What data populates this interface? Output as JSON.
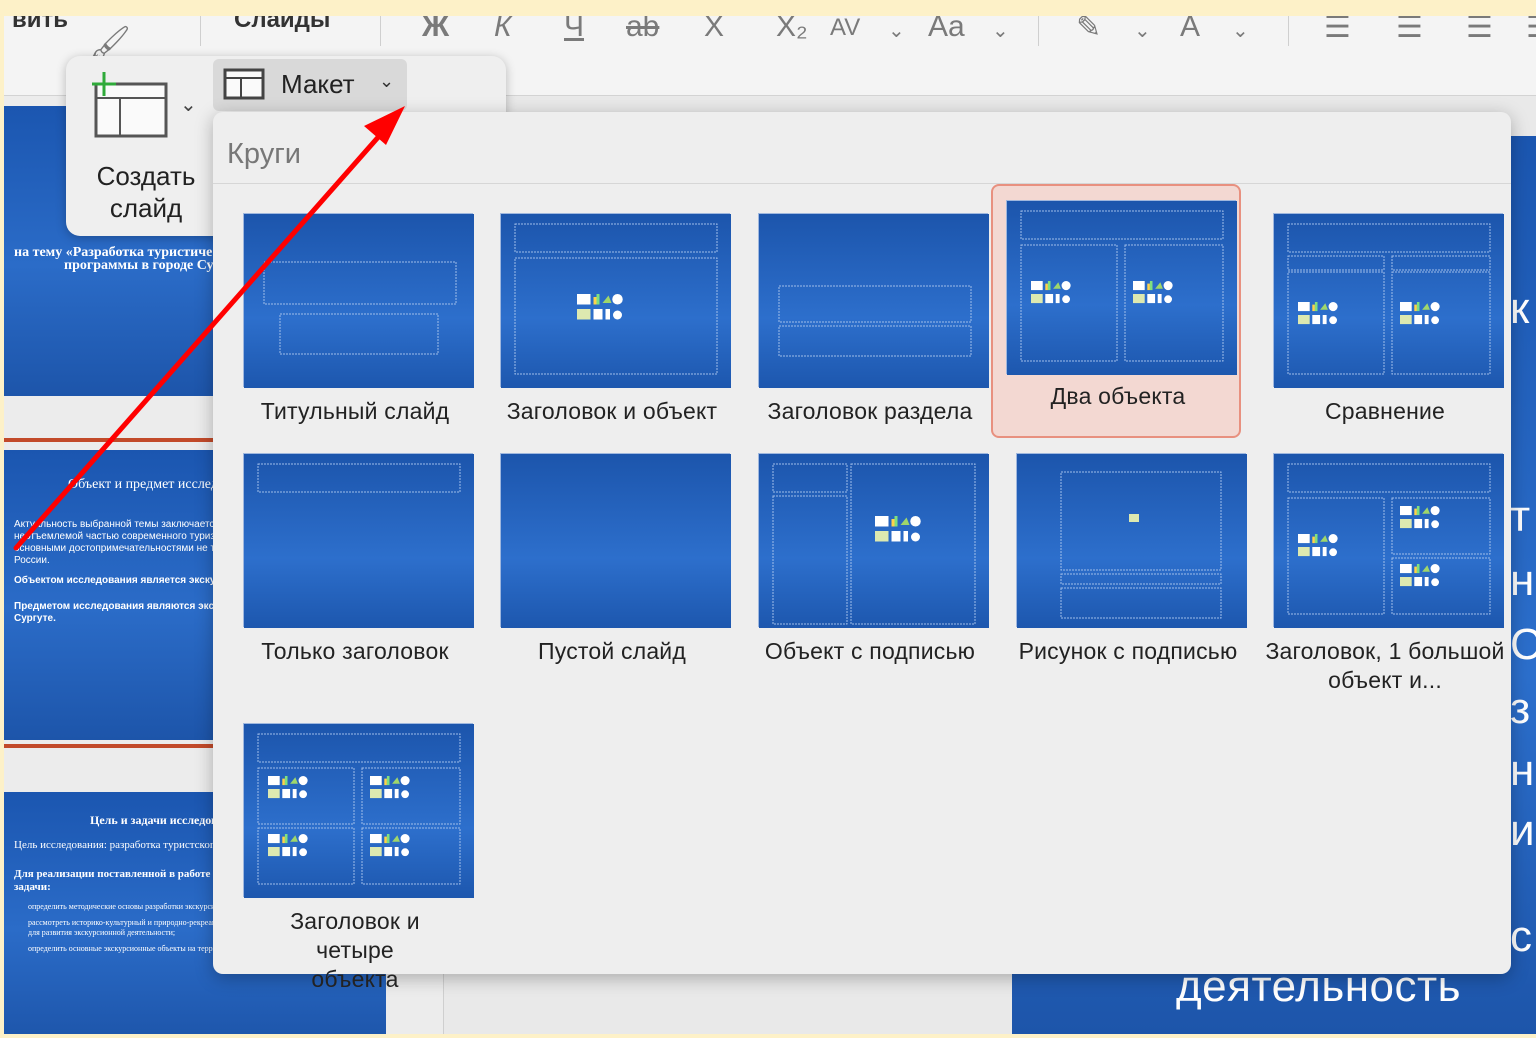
{
  "ribbon": {
    "clipped_left": "вить",
    "slides_tab": "Слайды",
    "font_buttons": [
      "Ж",
      "К",
      "Ч",
      "ab",
      "X",
      "X₂",
      "AV",
      "Aa"
    ]
  },
  "create_slide": {
    "label": "Создать слайд"
  },
  "layout_button": {
    "label": "Макет"
  },
  "gallery": {
    "title": "Круги",
    "layouts": [
      {
        "label": "Титульный слайд",
        "type": "title",
        "selected": false
      },
      {
        "label": "Заголовок и объект",
        "type": "title-content",
        "selected": false
      },
      {
        "label": "Заголовок раздела",
        "type": "section",
        "selected": false
      },
      {
        "label": "Два объекта",
        "type": "two-content",
        "selected": true
      },
      {
        "label": "Сравнение",
        "type": "comparison",
        "selected": false
      },
      {
        "label": "Только заголовок",
        "type": "title-only",
        "selected": false
      },
      {
        "label": "Пустой слайд",
        "type": "blank",
        "selected": false
      },
      {
        "label": "Объект с подписью",
        "type": "content-caption",
        "selected": false
      },
      {
        "label": "Рисунок с подписью",
        "type": "picture-caption",
        "selected": false
      },
      {
        "label": "Заголовок, 1 большой объект и...",
        "type": "big-content",
        "selected": false
      },
      {
        "label": "Заголовок и четыре объекта",
        "type": "four-content",
        "selected": false
      }
    ]
  },
  "thumbnails": {
    "slide1": {
      "line1": "на тему «Разработка туристической",
      "line2": "программы в городе Сургуте»"
    },
    "slide2": {
      "heading": "Объект и предмет исследования",
      "p1": "Актуальность выбранной темы заключается в том, что экскурсия является неотъемлемой частью современного туризма и позволяет знакомиться с основными достопримечательностями не только городов, но и городов России.",
      "p2": "Объектом исследования является экскурсионная деятельность.",
      "p3": "Предметом исследования являются экскурсионные объекты в городе Сургуте."
    },
    "slide3": {
      "heading": "Цель и задачи исследования",
      "p1": "Цель исследования: разработка туристского продукта по городу Сургуту.",
      "p2": "Для реализации поставленной в работе цели решались следующие задачи:",
      "b1": "определить методические основы разработки экскурсионной деятельности;",
      "b2": "рассмотреть историко-культурный и природно-рекреационный потенциал города Сургута как базу для развития экскурсионной деятельности;",
      "b3": "определить основные экскурсионные объекты на территории города."
    }
  },
  "main_slide": {
    "bottom_text": "деятельность",
    "edge_letters": [
      "к",
      "т",
      "н",
      "С",
      "з",
      "н",
      "и",
      "с"
    ]
  },
  "colors": {
    "slide_blue": "#1f5fbd",
    "selection_fill": "#f3d8d2",
    "selection_border": "#e8907f",
    "annotation_arrow": "#ff0000"
  }
}
